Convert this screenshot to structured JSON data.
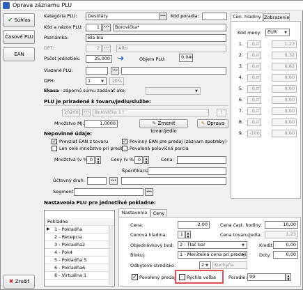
{
  "window": {
    "title": "Oprava záznamu PLU"
  },
  "left_buttons": {
    "save": "Súhlas",
    "cash_plu": "Časové PLU",
    "ean": "EAN",
    "cancel": "Zrušiť"
  },
  "form": {
    "category_label": "Kategória PLU:",
    "category_value": "Destiláty",
    "code_label": "Kód poradia:",
    "code_value": "",
    "code_name_label": "Kód a názov PLU:",
    "code_name_code": "1",
    "code_name_name": "Borovička*",
    "note_label": "Poznámka:",
    "note_value": "Bla bla",
    "dpt_label": "DPT:",
    "dpt_code": "2",
    "dpt_name": "Alko",
    "units_label": "Počet jednotiek:",
    "units_value": "25,000",
    "volume_label": "Objem PLU:",
    "volume_value": "0,040",
    "bound_label": "Viazané PLU:",
    "bound_value": "",
    "vat_label": "DPH:",
    "vat_code": "1",
    "vat_percent": "20%",
    "ekasa_label": "Ekasa",
    "ekasa_desc": "- zápornú sumu zadávať ako:",
    "ekasa_value": ""
  },
  "assign": {
    "heading": "PLU je priradené k tovaru/jedlu/službe:",
    "code": "202001",
    "name": "Borovička 1 l",
    "unit": "l",
    "qty_label": "Množstvo MJ:",
    "qty_value": "1,0000",
    "change_btn": "Zmeniť tovar/jedlo",
    "edit_btn": "Oprava"
  },
  "optional": {
    "heading": "Nepovinné údaje:",
    "cb1": "Prevziať EAN z tovaru",
    "cb2": "Povinný EAN pre predaj (záznam spotreby)",
    "cb3": "Len celé množstvo pri predaji",
    "cb4": "Povolená polovičná porcia",
    "qty_pct_label": "Množstva (v %):",
    "qty_pct_value": "0",
    "price_pct_label": "Ceny (v %):",
    "price_pct_value": "0",
    "price_label": "Cena:",
    "price_value": "",
    "spec_label": "Špecifikácia:",
    "spec_value": "",
    "acc_label": "Účtovný druh:",
    "acc_value": "",
    "segment_label": "Segment:",
    "segment_value": ""
  },
  "right_tabs": {
    "tab1": "Cen. hladiny",
    "tab2": "Zobrazenie"
  },
  "currency": {
    "label": "Kód meny:",
    "value": "EUR"
  },
  "price_levels": [
    {
      "n": "1.",
      "a": "0,0",
      "b": "1,23"
    },
    {
      "n": "2.",
      "a": "0,0",
      "b": "0,32"
    },
    {
      "n": "3.",
      "a": "0,0",
      "b": "0,82"
    },
    {
      "n": "4.",
      "a": "0,0",
      "b": "0,00"
    },
    {
      "n": "5.",
      "a": "0,0",
      "b": "0,00"
    },
    {
      "n": "6.",
      "a": "0,0",
      "b": "0,00"
    },
    {
      "n": "7.",
      "a": "0,0",
      "b": "0,00"
    },
    {
      "n": "8.",
      "a": "0,0",
      "b": "0,00"
    },
    {
      "n": "9.",
      "a": "-100,0",
      "b": "0,00"
    }
  ],
  "pos": {
    "heading": "Nastavenia PLU pre jednotlivé pokladne:",
    "table_header": "Pokladne",
    "rows": [
      "1 - Pokladňa",
      "2 - Recepcia",
      "3 - Pokladňa2",
      "4 - Pok4",
      "5 - Pokladňa 5",
      "6 - Pokladňa6",
      "8 - Virtuálna 1"
    ],
    "tabs": {
      "tab1": "Nastavenia",
      "tab2": "Ceny"
    },
    "price_label": "Cena:",
    "price_value": "2,00",
    "level_label": "Cenová hladina:",
    "level_value": "1",
    "order_label": "Objednávkový bod:",
    "order_value": "2 - Tlač bar",
    "block_label": "Blokuj:",
    "block_value": "1 - Menitelná cena pri predaji",
    "center_label": "Odbytové stredisko:",
    "center_code": "2",
    "center_name": "Kuchyňa",
    "hourly_label": "Cena čast. hodiny:",
    "hourly_value": "10,00",
    "level_price_label": "Cena tovaru/jedla:",
    "level_price_value": "1,23",
    "credit_label": "Kredit:",
    "credit_value": "0,00",
    "tax_label": "Doty:",
    "tax_value": "0,00",
    "allowed_sale": "Povolený predaj",
    "quick_choice": "Rýchla voľba",
    "order_no_label": "Poradie:",
    "order_no_value": "99"
  }
}
